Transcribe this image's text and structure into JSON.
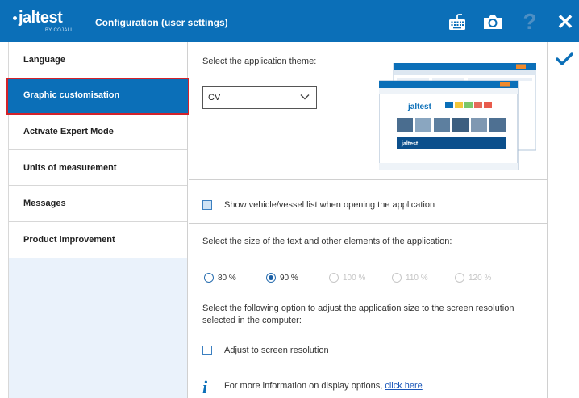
{
  "header": {
    "logo_text": "jaltest",
    "logo_sub": "BY COJALI",
    "title": "Configuration (user settings)"
  },
  "sidebar": {
    "items": [
      {
        "label": "Language"
      },
      {
        "label": "Graphic customisation",
        "active": true
      },
      {
        "label": "Activate Expert Mode"
      },
      {
        "label": "Units of measurement"
      },
      {
        "label": "Messages"
      },
      {
        "label": "Product improvement"
      }
    ]
  },
  "main": {
    "theme_label": "Select the application theme:",
    "theme_value": "CV",
    "show_list_label": "Show vehicle/vessel list when opening the application",
    "size_label": "Select the size of the text and other elements of the application:",
    "size_options": [
      {
        "label": "80 %",
        "selected": false,
        "enabled": true
      },
      {
        "label": "90 %",
        "selected": true,
        "enabled": true
      },
      {
        "label": "100 %",
        "selected": false,
        "enabled": false
      },
      {
        "label": "110 %",
        "selected": false,
        "enabled": false
      },
      {
        "label": "120 %",
        "selected": false,
        "enabled": false
      }
    ],
    "resolution_label_line1": "Select the following option to adjust the application size to the screen resolution",
    "resolution_label_line2": "selected in the computer:",
    "adjust_label": "Adjust to screen resolution",
    "info_text": "For more information on display options,",
    "info_link": "click here"
  },
  "colors": {
    "header_bg": "#0b6fb8",
    "active_bg": "#0b6fb8",
    "highlight_border": "#d3222a"
  }
}
